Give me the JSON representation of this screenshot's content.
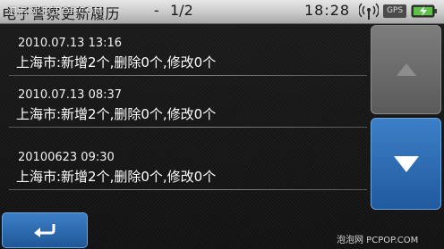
{
  "status_bar": {
    "title": "电子警察更新履历",
    "separator": "-",
    "page_indicator": "1/2",
    "clock": "18:28",
    "gps_label": "GPS",
    "signal_icon": "signal-antenna-icon",
    "battery_icon": "battery-charging-icon"
  },
  "watermarks": {
    "top": "泡泡网 PCPOP.COM",
    "bottom": "泡泡网 PCPOP.COM"
  },
  "entries": [
    {
      "time": "2010.07.13  13:16",
      "detail": "上海市:新增2个,删除0个,修改0个"
    },
    {
      "time": "2010.07.13  08:37",
      "detail": "上海市:新增2个,删除0个,修改0个"
    },
    {
      "time": "20100623  09:30",
      "detail": "上海市:新增2个,删除0个,修改0个"
    }
  ],
  "controls": {
    "scroll_up_icon": "triangle-up-icon",
    "scroll_down_icon": "triangle-down-icon",
    "back_icon": "return-arrow-icon"
  },
  "colors": {
    "accent_blue": "#2e6fb8",
    "disabled_gray": "#6b6b6b",
    "status_bar": "#c9c9c9"
  }
}
